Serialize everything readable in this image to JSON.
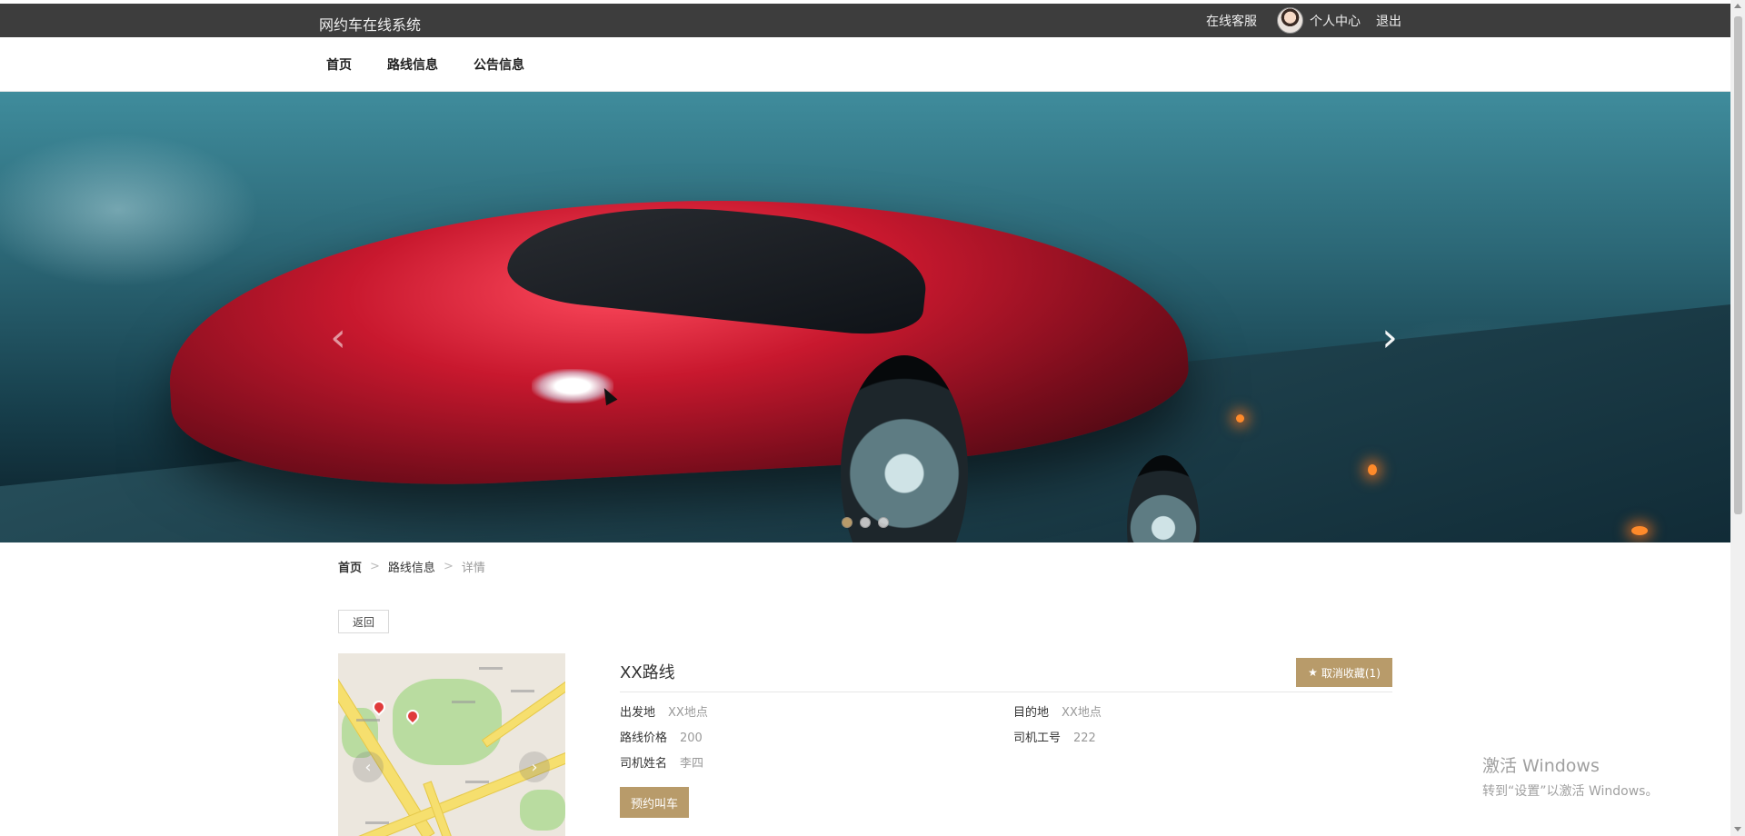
{
  "header": {
    "brand": "网约车在线系统",
    "service": "在线客服",
    "profile": "个人中心",
    "logout": "退出"
  },
  "nav": [
    "首页",
    "路线信息",
    "公告信息"
  ],
  "carousel": {
    "prev_icon": "‹",
    "next_icon": "›",
    "slide_count": 3,
    "active_slide": 1
  },
  "breadcrumb": {
    "home": "首页",
    "section": "路线信息",
    "current": "详情",
    "separator": ">"
  },
  "back_label": "返回",
  "map": {
    "prev_icon": "‹",
    "next_icon": "›"
  },
  "detail": {
    "title": "XX路线",
    "favorite_label": "取消收藏(1)",
    "fields": [
      {
        "label": "出发地",
        "value": "XX地点"
      },
      {
        "label": "目的地",
        "value": "XX地点"
      },
      {
        "label": "路线价格",
        "value": "200"
      },
      {
        "label": "司机工号",
        "value": "222"
      },
      {
        "label": "司机姓名",
        "value": "李四"
      }
    ],
    "book_label": "预约叫车"
  },
  "watermark": {
    "line1": "激活 Windows",
    "line2": "转到“设置”以激活 Windows。"
  },
  "colors": {
    "accent": "#b89b6a",
    "topbar": "#3d3d3d"
  }
}
